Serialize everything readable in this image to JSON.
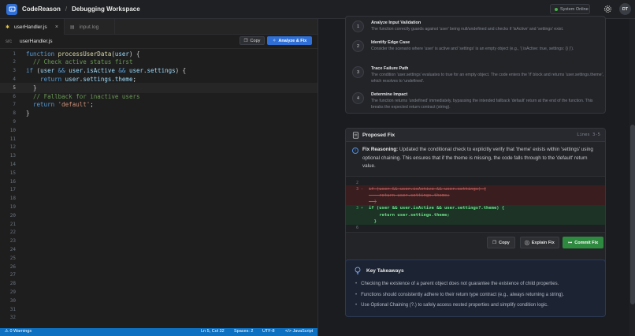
{
  "header": {
    "brand": "CodeReason",
    "separator": "/",
    "workspace": "Debugging Workspace",
    "status": "System Online",
    "avatar_initials": "DT",
    "status_color": "#4caf50"
  },
  "editor": {
    "tabs": [
      {
        "label": "userHandler.js",
        "icon": "js-file-icon",
        "active": true
      },
      {
        "label": "input.log",
        "icon": "log-file-icon",
        "active": false
      }
    ],
    "breadcrumb": {
      "root": "src",
      "file": "userHandler.js"
    },
    "copy_label": "Copy",
    "analyze_label": "Analyze & Fix",
    "current_line": 5,
    "line_count": 32
  },
  "statusbar": {
    "warnings": "0 Warnings",
    "position": "Ln 5, Col 32",
    "spaces": "Spaces: 2",
    "encoding": "UTF-8",
    "language": "JavaScript"
  },
  "analysis_steps": [
    {
      "num": "1",
      "title": "Analyze Input Validation",
      "desc": "The function correctly guards against 'user' being null/undefined and checks if 'isActive' and 'settings' exist."
    },
    {
      "num": "2",
      "title": "Identify Edge Case",
      "desc": "Consider the scenario where 'user' is active and 'settings' is an empty object (e.g., '{ isActive: true, settings: {} }')."
    },
    {
      "num": "3",
      "title": "Trace Failure Path",
      "desc": "The condition 'user.settings' evaluates to true for an empty object. The code enters the 'if' block and returns 'user.settings.theme', which resolves to 'undefined'."
    },
    {
      "num": "4",
      "title": "Determine Impact",
      "desc": "The function returns 'undefined' immediately, bypassing the intended fallback 'default' return at the end of the function. This breaks the expected return contract (string)."
    }
  ],
  "proposed_fix": {
    "title": "Proposed Fix",
    "lines": "Lines 3-5",
    "reasoning_label": "Fix Reasoning:",
    "reasoning": "Updated the conditional check to explicitly verify that 'theme' exists within 'settings' using optional chaining. This ensures that if the theme is missing, the code falls through to the 'default' return value.",
    "copy_label": "Copy",
    "explain_label": "Explain Fix",
    "commit_label": "Commit Fix"
  },
  "takeaways": {
    "title": "Key Takeaways",
    "items": [
      "Checking the existence of a parent object does not guarantee the existence of child properties.",
      "Functions should consistently adhere to their return type contract (e.g., always returning a string).",
      "Use Optional Chaining (?.) to safely access nested properties and simplify condition logic."
    ]
  },
  "diff_lines": [
    {
      "num": "2",
      "sign": "",
      "text": "",
      "type": "ctx"
    },
    {
      "num": "3",
      "sign": "-",
      "text": "if (user && user.isActive && user.settings) {",
      "type": "del"
    },
    {
      "num": "",
      "sign": "",
      "text": "    return user.settings.theme;",
      "type": "del"
    },
    {
      "num": "",
      "sign": "",
      "text": "  }",
      "type": "del"
    },
    {
      "num": "3",
      "sign": "+",
      "text": "if (user && user.isActive && user.settings?.theme) {",
      "type": "add"
    },
    {
      "num": "",
      "sign": "",
      "text": "    return user.settings.theme;",
      "type": "add"
    },
    {
      "num": "",
      "sign": "",
      "text": "  }",
      "type": "add"
    },
    {
      "num": "6",
      "sign": "",
      "text": "",
      "type": "ctx"
    }
  ],
  "code_lines": [
    {
      "n": "1",
      "html_parts": [
        [
          "kw",
          "function "
        ],
        [
          "fn",
          "processUserData"
        ],
        [
          "op",
          "("
        ],
        [
          "var",
          "user"
        ],
        [
          "op",
          ") {"
        ]
      ]
    },
    {
      "n": "2",
      "html_parts": [
        [
          "cm",
          "  // Check active status first"
        ]
      ]
    },
    {
      "n": "3",
      "html_parts": [
        [
          "kw",
          "if "
        ],
        [
          "op",
          "("
        ],
        [
          "var",
          "user"
        ],
        [
          "kw",
          " && "
        ],
        [
          "var",
          "user"
        ],
        [
          "op",
          "."
        ],
        [
          "var",
          "isActive"
        ],
        [
          "kw",
          " && "
        ],
        [
          "var",
          "user"
        ],
        [
          "op",
          "."
        ],
        [
          "var",
          "settings"
        ],
        [
          "op",
          ") {"
        ]
      ]
    },
    {
      "n": "4",
      "html_parts": [
        [
          "kw",
          "    return "
        ],
        [
          "var",
          "user"
        ],
        [
          "op",
          "."
        ],
        [
          "var",
          "settings"
        ],
        [
          "op",
          "."
        ],
        [
          "var",
          "theme"
        ],
        [
          "op",
          ";"
        ]
      ]
    },
    {
      "n": "5",
      "html_parts": [
        [
          "op",
          "  }"
        ]
      ]
    },
    {
      "n": "6",
      "html_parts": [
        [
          "cm",
          "  // Fallback for inactive users"
        ]
      ]
    },
    {
      "n": "7",
      "html_parts": [
        [
          "kw",
          "  return "
        ],
        [
          "str",
          "'default'"
        ],
        [
          "op",
          ";"
        ]
      ]
    },
    {
      "n": "8",
      "html_parts": [
        [
          "op",
          "}"
        ]
      ]
    }
  ]
}
